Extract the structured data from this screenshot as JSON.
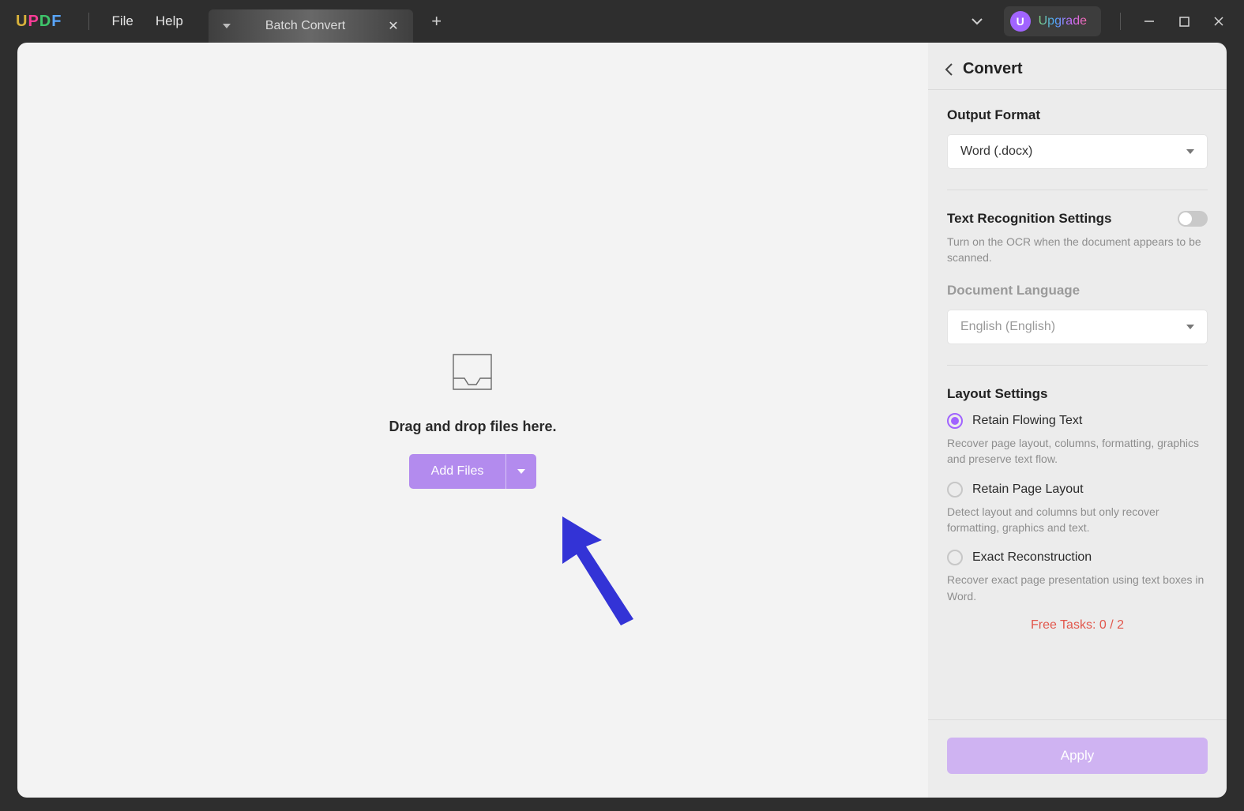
{
  "menu": {
    "file": "File",
    "help": "Help"
  },
  "tab": {
    "label": "Batch Convert"
  },
  "upgrade": {
    "avatar": "U",
    "label": "Upgrade"
  },
  "dropzone": {
    "label": "Drag and drop files here.",
    "addfiles": "Add Files"
  },
  "sidebar": {
    "title": "Convert",
    "output_format_label": "Output Format",
    "output_format_value": "Word (.docx)",
    "ocr_label": "Text Recognition Settings",
    "ocr_desc": "Turn on the OCR when the document appears to be scanned.",
    "doclang_label": "Document Language",
    "doclang_value": "English (English)",
    "layout_label": "Layout Settings",
    "layout_options": [
      {
        "label": "Retain Flowing Text",
        "desc": "Recover page layout, columns, formatting, graphics and preserve text flow."
      },
      {
        "label": "Retain Page Layout",
        "desc": "Detect layout and columns but only recover formatting, graphics and text."
      },
      {
        "label": "Exact Reconstruction",
        "desc": "Recover exact page presentation using text boxes in Word."
      }
    ],
    "free_tasks": "Free Tasks: 0 / 2",
    "apply": "Apply"
  }
}
